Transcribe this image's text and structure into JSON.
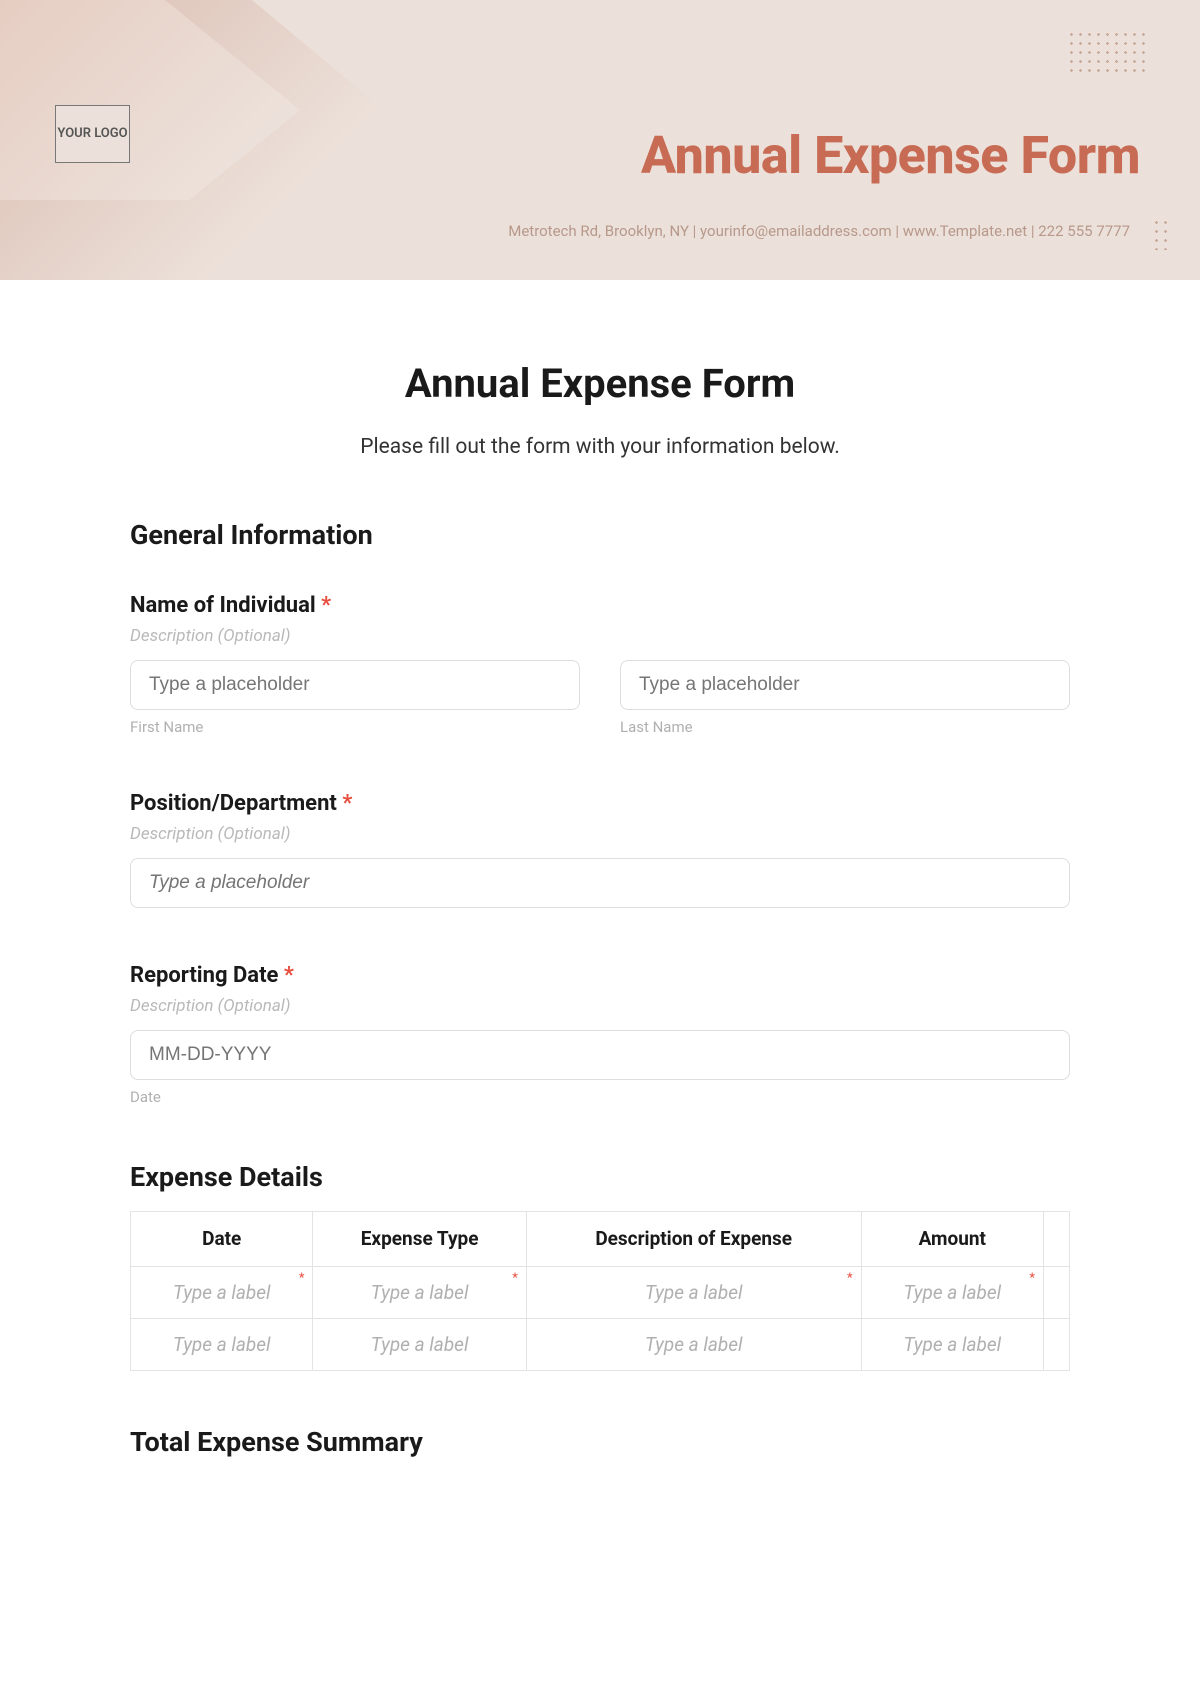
{
  "banner": {
    "logo_text": "YOUR LOGO",
    "title": "Annual Expense Form",
    "contact_line": "Metrotech Rd, Brooklyn, NY  |  yourinfo@emailaddress.com  |  www.Template.net  |  222 555 7777"
  },
  "form": {
    "title": "Annual Expense Form",
    "subtitle": "Please fill out the form with your information below."
  },
  "sections": {
    "general_info": {
      "heading": "General Information",
      "name_field": {
        "label": "Name of Individual",
        "required_mark": "*",
        "description": "Description (Optional)",
        "first_placeholder": "Type a placeholder",
        "first_sublabel": "First Name",
        "last_placeholder": "Type a placeholder",
        "last_sublabel": "Last Name"
      },
      "position_field": {
        "label": "Position/Department",
        "required_mark": "*",
        "description": "Description (Optional)",
        "placeholder": "Type a placeholder"
      },
      "date_field": {
        "label": "Reporting Date",
        "required_mark": "*",
        "description": "Description (Optional)",
        "placeholder": "MM-DD-YYYY",
        "sublabel": "Date"
      }
    },
    "expense_details": {
      "heading": "Expense Details",
      "columns": [
        "Date",
        "Expense Type",
        "Description of Expense",
        "Amount"
      ],
      "rows": [
        {
          "required": true,
          "cells": [
            "Type a label",
            "Type a label",
            "Type a label",
            "Type a label"
          ]
        },
        {
          "required": false,
          "cells": [
            "Type a label",
            "Type a label",
            "Type a label",
            "Type a label"
          ]
        }
      ]
    },
    "summary": {
      "heading": "Total Expense Summary"
    }
  }
}
